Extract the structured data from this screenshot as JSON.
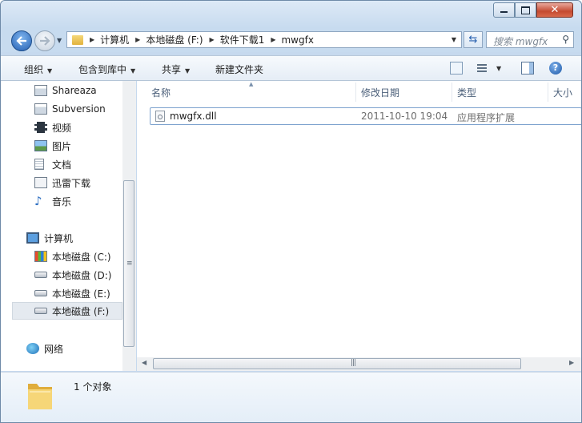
{
  "address": {
    "crumbs": [
      "计算机",
      "本地磁盘 (F:)",
      "软件下载1",
      "mwgfx"
    ]
  },
  "search": {
    "placeholder": "搜索 mwgfx"
  },
  "toolbar": {
    "organize": "组织",
    "include_in_library": "包含到库中",
    "share": "共享",
    "new_folder": "新建文件夹"
  },
  "sidebar": {
    "items": [
      {
        "label": "Shareaza",
        "icon": "app-icon"
      },
      {
        "label": "Subversion",
        "icon": "app-icon"
      },
      {
        "label": "视频",
        "icon": "video-icon"
      },
      {
        "label": "图片",
        "icon": "picture-icon"
      },
      {
        "label": "文档",
        "icon": "document-icon"
      },
      {
        "label": "迅雷下载",
        "icon": "download-folder-icon"
      },
      {
        "label": "音乐",
        "icon": "music-icon"
      }
    ],
    "computer": "计算机",
    "drives": [
      {
        "label": "本地磁盘 (C:)",
        "selected": false
      },
      {
        "label": "本地磁盘 (D:)",
        "selected": false
      },
      {
        "label": "本地磁盘 (E:)",
        "selected": false
      },
      {
        "label": "本地磁盘 (F:)",
        "selected": true
      }
    ],
    "network": "网络"
  },
  "columns": {
    "name": "名称",
    "modified": "修改日期",
    "type": "类型",
    "size": "大小"
  },
  "files": [
    {
      "name": "mwgfx.dll",
      "modified": "2011-10-10 19:04",
      "type": "应用程序扩展"
    }
  ],
  "status": {
    "count": "1 个对象"
  },
  "colors": {
    "accent": "#245fb1",
    "selection": "#e5eaf0"
  }
}
